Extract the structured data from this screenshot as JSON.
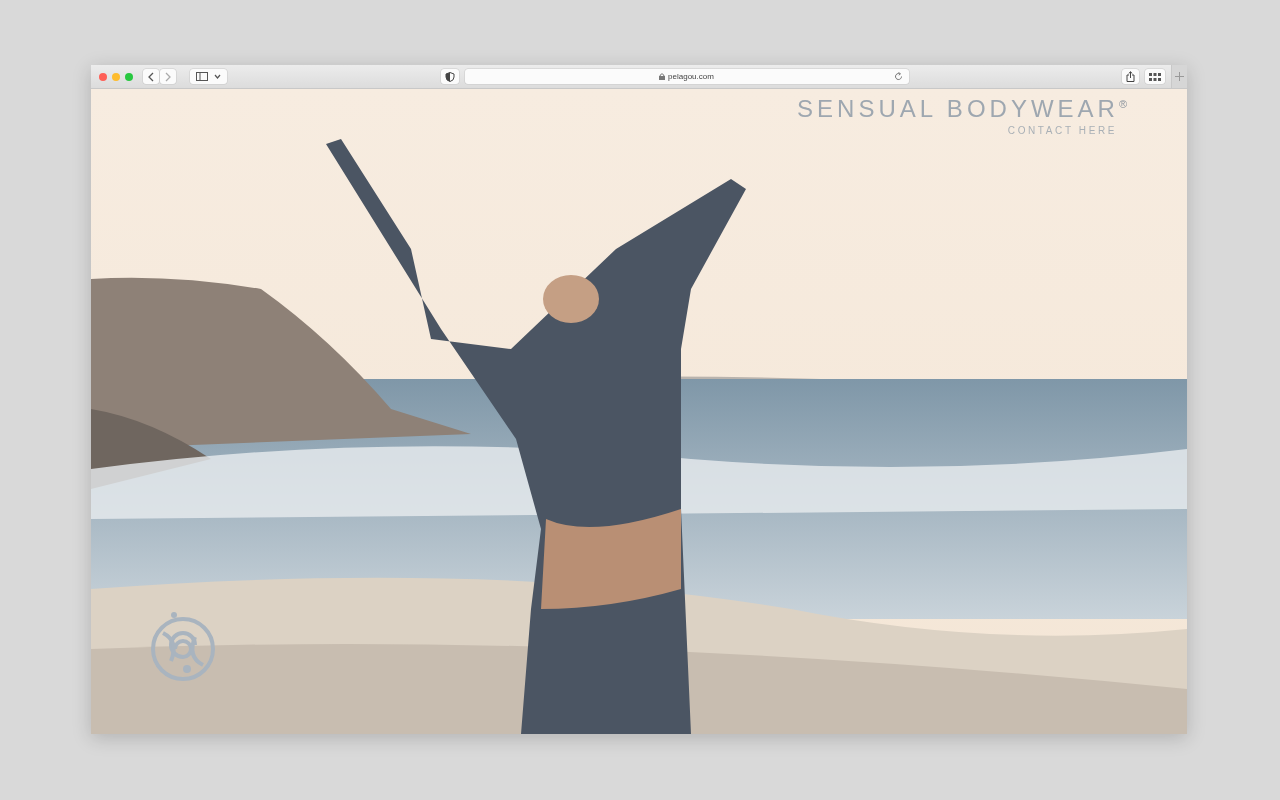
{
  "browser": {
    "url": "pelagou.com"
  },
  "page": {
    "brand": "SENSUAL BODYWEAR$^{®}$",
    "contact_link": "CONTACT HERE"
  }
}
